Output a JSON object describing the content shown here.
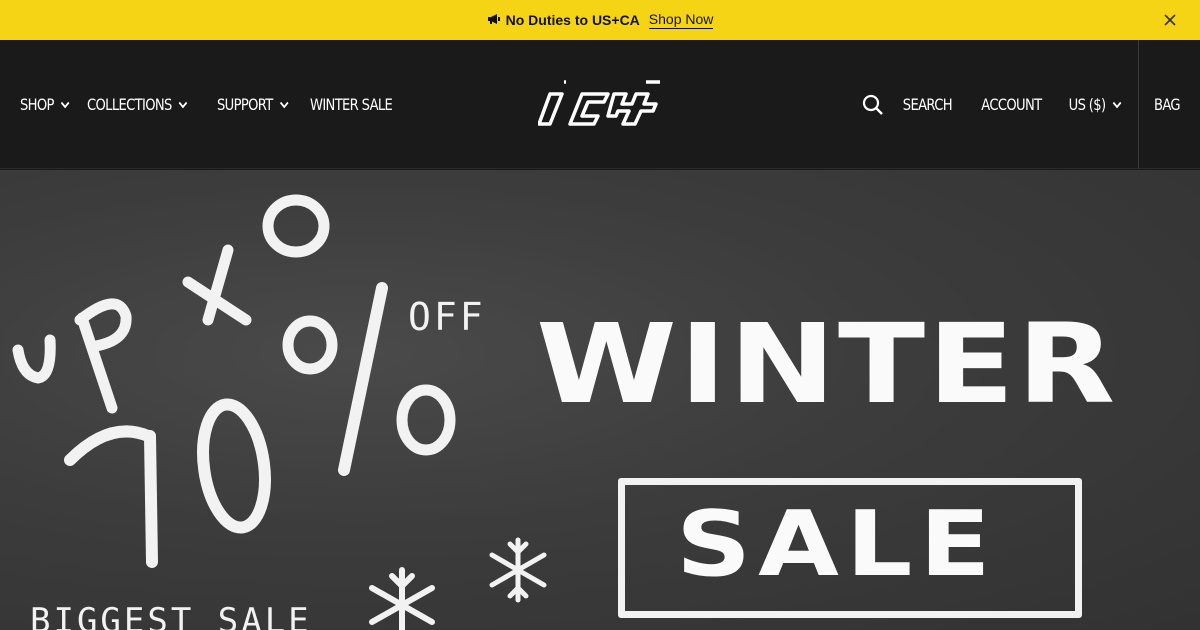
{
  "announcement": {
    "icon": "megaphone-icon",
    "message": "No Duties to US+CA",
    "link": "Shop Now"
  },
  "nav": {
    "left": [
      "SHOP",
      "COLLECTIONS",
      "SUPPORT",
      "WINTER SALE"
    ],
    "search": "SEARCH",
    "account": "ACCOUNT",
    "currency": "US ($)",
    "bag": "BAG"
  },
  "logo": {
    "text": "ICY"
  },
  "hero": {
    "line1": "up to",
    "line2": "70%",
    "off": "OFF",
    "title": "WINTER",
    "sale": "SALE",
    "tagline": "BIGGEST SALE"
  },
  "colors": {
    "announcement_bg": "#f5d416",
    "header_bg": "#1a1a1a",
    "hero_bg": "#3c3c3c",
    "chalk": "#f2f2f2"
  }
}
